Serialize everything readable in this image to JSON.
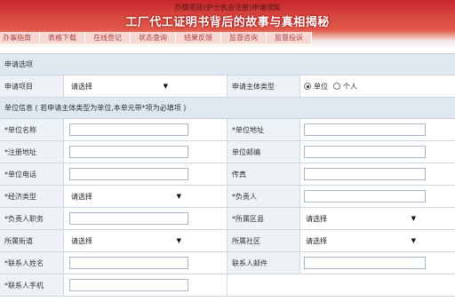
{
  "header": {
    "notice": "办理项目(护士执业注册)申请须知",
    "headline": "工厂代工证明书背后的故事与真相揭秘"
  },
  "tabs": [
    "办事指南",
    "表格下载",
    "在线登记",
    "状态查询",
    "结果反馈",
    "监督咨询",
    "监督投诉"
  ],
  "section_apply": "申请选项",
  "apply_row": {
    "item_label": "申请项目",
    "item_value": "请选择",
    "subject_label": "申请主体类型",
    "option_unit": "单位",
    "option_person": "个人"
  },
  "section_unit": "单位信息 ( 若申请主体类型为单位,本单元带*项为必填项 )",
  "rows": [
    {
      "l1": "*单位名称",
      "t1": "input",
      "l2": "*单位地址",
      "t2": "input"
    },
    {
      "l1": "*注册地址",
      "t1": "input",
      "l2": "单位邮编",
      "t2": "input"
    },
    {
      "l1": "*单位电话",
      "t1": "input",
      "l2": "传真",
      "t2": "input"
    },
    {
      "l1": "*经济类型",
      "t1": "select",
      "v1": "请选择",
      "l2": "*负责人",
      "t2": "input"
    },
    {
      "l1": "*负责人职务",
      "t1": "input",
      "l2": "*所属区县",
      "t2": "select",
      "v2": "请选择"
    },
    {
      "l1": "所属街道",
      "t1": "select",
      "v1": "请选择",
      "l2": "所属社区",
      "t2": "select",
      "v2": "请选择"
    },
    {
      "l1": "*联系人姓名",
      "t1": "input",
      "l2": "联系人邮件",
      "t2": "input"
    },
    {
      "l1": "*联系人手机",
      "t1": "input"
    }
  ],
  "icons": {
    "dropdown": "dropdown-arrow-icon"
  }
}
